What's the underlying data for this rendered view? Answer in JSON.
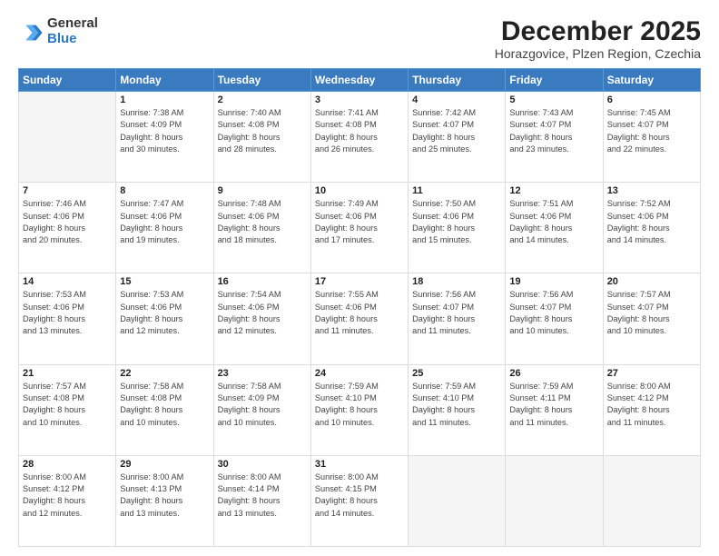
{
  "header": {
    "logo_general": "General",
    "logo_blue": "Blue",
    "title": "December 2025",
    "subtitle": "Horazgovice, Plzen Region, Czechia"
  },
  "weekdays": [
    "Sunday",
    "Monday",
    "Tuesday",
    "Wednesday",
    "Thursday",
    "Friday",
    "Saturday"
  ],
  "weeks": [
    [
      {
        "day": "",
        "info": ""
      },
      {
        "day": "1",
        "info": "Sunrise: 7:38 AM\nSunset: 4:09 PM\nDaylight: 8 hours\nand 30 minutes."
      },
      {
        "day": "2",
        "info": "Sunrise: 7:40 AM\nSunset: 4:08 PM\nDaylight: 8 hours\nand 28 minutes."
      },
      {
        "day": "3",
        "info": "Sunrise: 7:41 AM\nSunset: 4:08 PM\nDaylight: 8 hours\nand 26 minutes."
      },
      {
        "day": "4",
        "info": "Sunrise: 7:42 AM\nSunset: 4:07 PM\nDaylight: 8 hours\nand 25 minutes."
      },
      {
        "day": "5",
        "info": "Sunrise: 7:43 AM\nSunset: 4:07 PM\nDaylight: 8 hours\nand 23 minutes."
      },
      {
        "day": "6",
        "info": "Sunrise: 7:45 AM\nSunset: 4:07 PM\nDaylight: 8 hours\nand 22 minutes."
      }
    ],
    [
      {
        "day": "7",
        "info": "Sunrise: 7:46 AM\nSunset: 4:06 PM\nDaylight: 8 hours\nand 20 minutes."
      },
      {
        "day": "8",
        "info": "Sunrise: 7:47 AM\nSunset: 4:06 PM\nDaylight: 8 hours\nand 19 minutes."
      },
      {
        "day": "9",
        "info": "Sunrise: 7:48 AM\nSunset: 4:06 PM\nDaylight: 8 hours\nand 18 minutes."
      },
      {
        "day": "10",
        "info": "Sunrise: 7:49 AM\nSunset: 4:06 PM\nDaylight: 8 hours\nand 17 minutes."
      },
      {
        "day": "11",
        "info": "Sunrise: 7:50 AM\nSunset: 4:06 PM\nDaylight: 8 hours\nand 15 minutes."
      },
      {
        "day": "12",
        "info": "Sunrise: 7:51 AM\nSunset: 4:06 PM\nDaylight: 8 hours\nand 14 minutes."
      },
      {
        "day": "13",
        "info": "Sunrise: 7:52 AM\nSunset: 4:06 PM\nDaylight: 8 hours\nand 14 minutes."
      }
    ],
    [
      {
        "day": "14",
        "info": "Sunrise: 7:53 AM\nSunset: 4:06 PM\nDaylight: 8 hours\nand 13 minutes."
      },
      {
        "day": "15",
        "info": "Sunrise: 7:53 AM\nSunset: 4:06 PM\nDaylight: 8 hours\nand 12 minutes."
      },
      {
        "day": "16",
        "info": "Sunrise: 7:54 AM\nSunset: 4:06 PM\nDaylight: 8 hours\nand 12 minutes."
      },
      {
        "day": "17",
        "info": "Sunrise: 7:55 AM\nSunset: 4:06 PM\nDaylight: 8 hours\nand 11 minutes."
      },
      {
        "day": "18",
        "info": "Sunrise: 7:56 AM\nSunset: 4:07 PM\nDaylight: 8 hours\nand 11 minutes."
      },
      {
        "day": "19",
        "info": "Sunrise: 7:56 AM\nSunset: 4:07 PM\nDaylight: 8 hours\nand 10 minutes."
      },
      {
        "day": "20",
        "info": "Sunrise: 7:57 AM\nSunset: 4:07 PM\nDaylight: 8 hours\nand 10 minutes."
      }
    ],
    [
      {
        "day": "21",
        "info": "Sunrise: 7:57 AM\nSunset: 4:08 PM\nDaylight: 8 hours\nand 10 minutes."
      },
      {
        "day": "22",
        "info": "Sunrise: 7:58 AM\nSunset: 4:08 PM\nDaylight: 8 hours\nand 10 minutes."
      },
      {
        "day": "23",
        "info": "Sunrise: 7:58 AM\nSunset: 4:09 PM\nDaylight: 8 hours\nand 10 minutes."
      },
      {
        "day": "24",
        "info": "Sunrise: 7:59 AM\nSunset: 4:10 PM\nDaylight: 8 hours\nand 10 minutes."
      },
      {
        "day": "25",
        "info": "Sunrise: 7:59 AM\nSunset: 4:10 PM\nDaylight: 8 hours\nand 11 minutes."
      },
      {
        "day": "26",
        "info": "Sunrise: 7:59 AM\nSunset: 4:11 PM\nDaylight: 8 hours\nand 11 minutes."
      },
      {
        "day": "27",
        "info": "Sunrise: 8:00 AM\nSunset: 4:12 PM\nDaylight: 8 hours\nand 11 minutes."
      }
    ],
    [
      {
        "day": "28",
        "info": "Sunrise: 8:00 AM\nSunset: 4:12 PM\nDaylight: 8 hours\nand 12 minutes."
      },
      {
        "day": "29",
        "info": "Sunrise: 8:00 AM\nSunset: 4:13 PM\nDaylight: 8 hours\nand 13 minutes."
      },
      {
        "day": "30",
        "info": "Sunrise: 8:00 AM\nSunset: 4:14 PM\nDaylight: 8 hours\nand 13 minutes."
      },
      {
        "day": "31",
        "info": "Sunrise: 8:00 AM\nSunset: 4:15 PM\nDaylight: 8 hours\nand 14 minutes."
      },
      {
        "day": "",
        "info": ""
      },
      {
        "day": "",
        "info": ""
      },
      {
        "day": "",
        "info": ""
      }
    ]
  ]
}
